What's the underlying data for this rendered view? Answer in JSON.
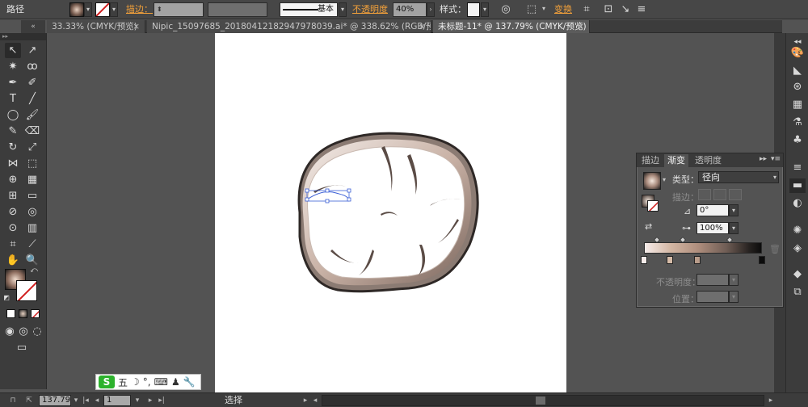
{
  "control_bar": {
    "object_type": "路径",
    "stroke_label": "描边：",
    "stroke_profile": "基本",
    "opacity_label": "不透明度",
    "opacity_value": "40%",
    "style_label": "样式：",
    "transform_label": "变换"
  },
  "tabs": {
    "collapse_glyph": "«",
    "items": [
      {
        "label": "33.33% (CMYK/预览)",
        "close": "×",
        "active": false
      },
      {
        "label": "Nipic_15097685_20180412182947978039.ai* @ 338.62% (RGB/预览)",
        "close": "×",
        "active": false
      },
      {
        "label": "未标题-11* @ 137.79% (CMYK/预览)",
        "close": "×",
        "active": true
      }
    ]
  },
  "gradient_panel": {
    "tabs": [
      "描边",
      "渐变",
      "透明度"
    ],
    "active_tab": "渐变",
    "menu_glyphs": [
      "▸▸",
      "▾≡"
    ],
    "type_label": "类型：",
    "type_value": "径向",
    "stroke_label": "描边：",
    "angle_value": "0°",
    "aspect_value": "100%",
    "opacity_label": "不透明度：",
    "location_label": "位置："
  },
  "status_bar": {
    "zoom": "137.79",
    "page": "1",
    "tool": "选择"
  },
  "ime": {
    "logo": "S",
    "label": "五",
    "moon": "☽",
    "dots": "°,"
  },
  "colors": {
    "accent_orange": "#f2a03a",
    "ui_dark": "#3c3c3c",
    "pasteboard": "#535353",
    "selection_blue": "#3b5fd6"
  }
}
